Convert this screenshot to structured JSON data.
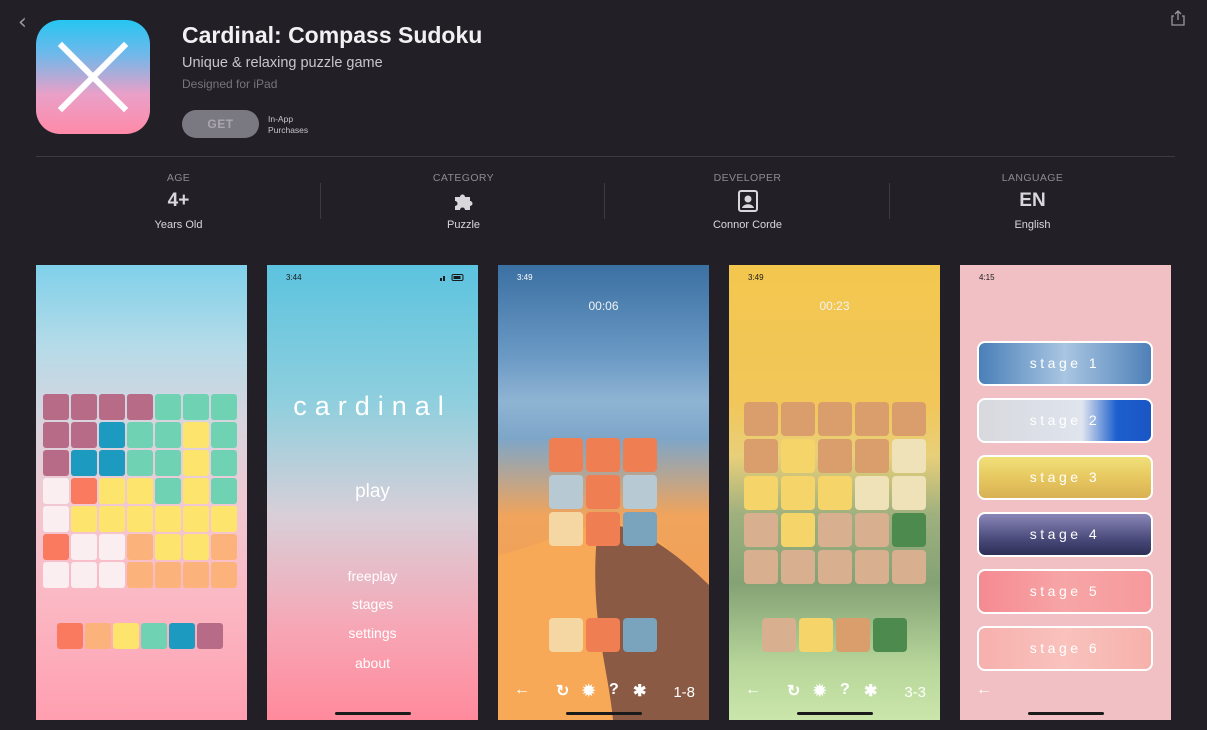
{
  "nav": {
    "back_icon": "chevron-left-icon",
    "share_icon": "share-icon"
  },
  "app": {
    "title": "Cardinal: Compass Sudoku",
    "subtitle": "Unique & relaxing puzzle game",
    "designed_for": "Designed for iPad",
    "get_label": "GET",
    "iap_line1": "In-App",
    "iap_line2": "Purchases"
  },
  "info": [
    {
      "label": "AGE",
      "value": "4+",
      "sub": "Years Old",
      "icon": ""
    },
    {
      "label": "CATEGORY",
      "value": "",
      "sub": "Puzzle",
      "icon": "puzzle-piece-icon"
    },
    {
      "label": "DEVELOPER",
      "value": "",
      "sub": "Connor Corde",
      "icon": "person-square-icon"
    },
    {
      "label": "LANGUAGE",
      "value": "EN",
      "sub": "English",
      "icon": ""
    }
  ],
  "screenshots": {
    "s2": {
      "time": "3:44",
      "title": "cardinal",
      "play": "play",
      "menu": [
        "freeplay",
        "stages",
        "settings",
        "about"
      ]
    },
    "s3": {
      "time": "3:49",
      "timer": "00:06",
      "level": "1-8"
    },
    "s4": {
      "time": "3:49",
      "timer": "00:23",
      "level": "3-3"
    },
    "s5": {
      "time": "4:15",
      "stages": [
        "stage 1",
        "stage 2",
        "stage 3",
        "stage 4",
        "stage 5",
        "stage 6"
      ]
    }
  },
  "colors": {
    "background": "#221f26",
    "get_button": "#7a7880"
  }
}
